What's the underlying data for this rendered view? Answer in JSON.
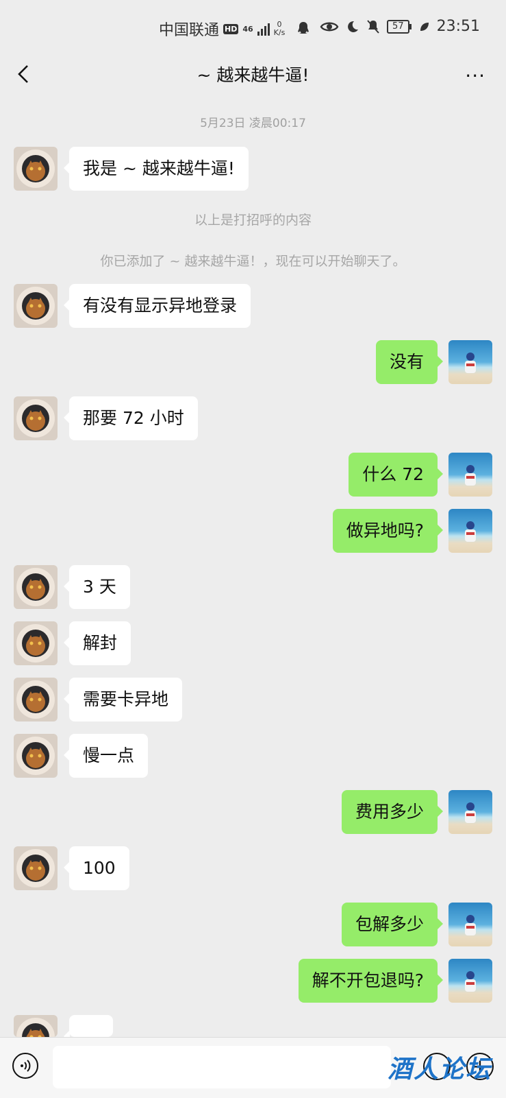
{
  "status_bar": {
    "carrier": "中国联通",
    "hd": "HD",
    "network": "46",
    "speed_value": "0",
    "speed_unit": "K/s",
    "battery": "57",
    "time": "23:51"
  },
  "header": {
    "title": "~ 越来越牛逼!",
    "more": "···"
  },
  "timestamp": "5月23日 凌晨00:17",
  "system_messages": [
    "以上是打招呼的内容",
    "你已添加了 ~ 越来越牛逼！，现在可以开始聊天了。"
  ],
  "messages": [
    {
      "from": "other",
      "text": "我是 ~ 越来越牛逼!"
    },
    {
      "from": "other",
      "text": "有没有显示异地登录"
    },
    {
      "from": "me",
      "text": "没有"
    },
    {
      "from": "other",
      "text": "那要 72 小时"
    },
    {
      "from": "me",
      "text": "什么 72"
    },
    {
      "from": "me",
      "text": "做异地吗?"
    },
    {
      "from": "other",
      "text": "3 天"
    },
    {
      "from": "other",
      "text": "解封"
    },
    {
      "from": "other",
      "text": "需要卡异地"
    },
    {
      "from": "other",
      "text": "慢一点"
    },
    {
      "from": "me",
      "text": "费用多少"
    },
    {
      "from": "other",
      "text": "100"
    },
    {
      "from": "me",
      "text": "包解多少"
    },
    {
      "from": "me",
      "text": "解不开包退吗?"
    }
  ],
  "input_bar": {
    "voice_icon": "voice-icon",
    "emoji_icon": "emoji-icon",
    "plus_icon": "plus-icon",
    "input_value": ""
  },
  "watermark": "酒人论坛",
  "colors": {
    "background": "#ededed",
    "my_bubble": "#95ec69",
    "other_bubble": "#ffffff"
  }
}
